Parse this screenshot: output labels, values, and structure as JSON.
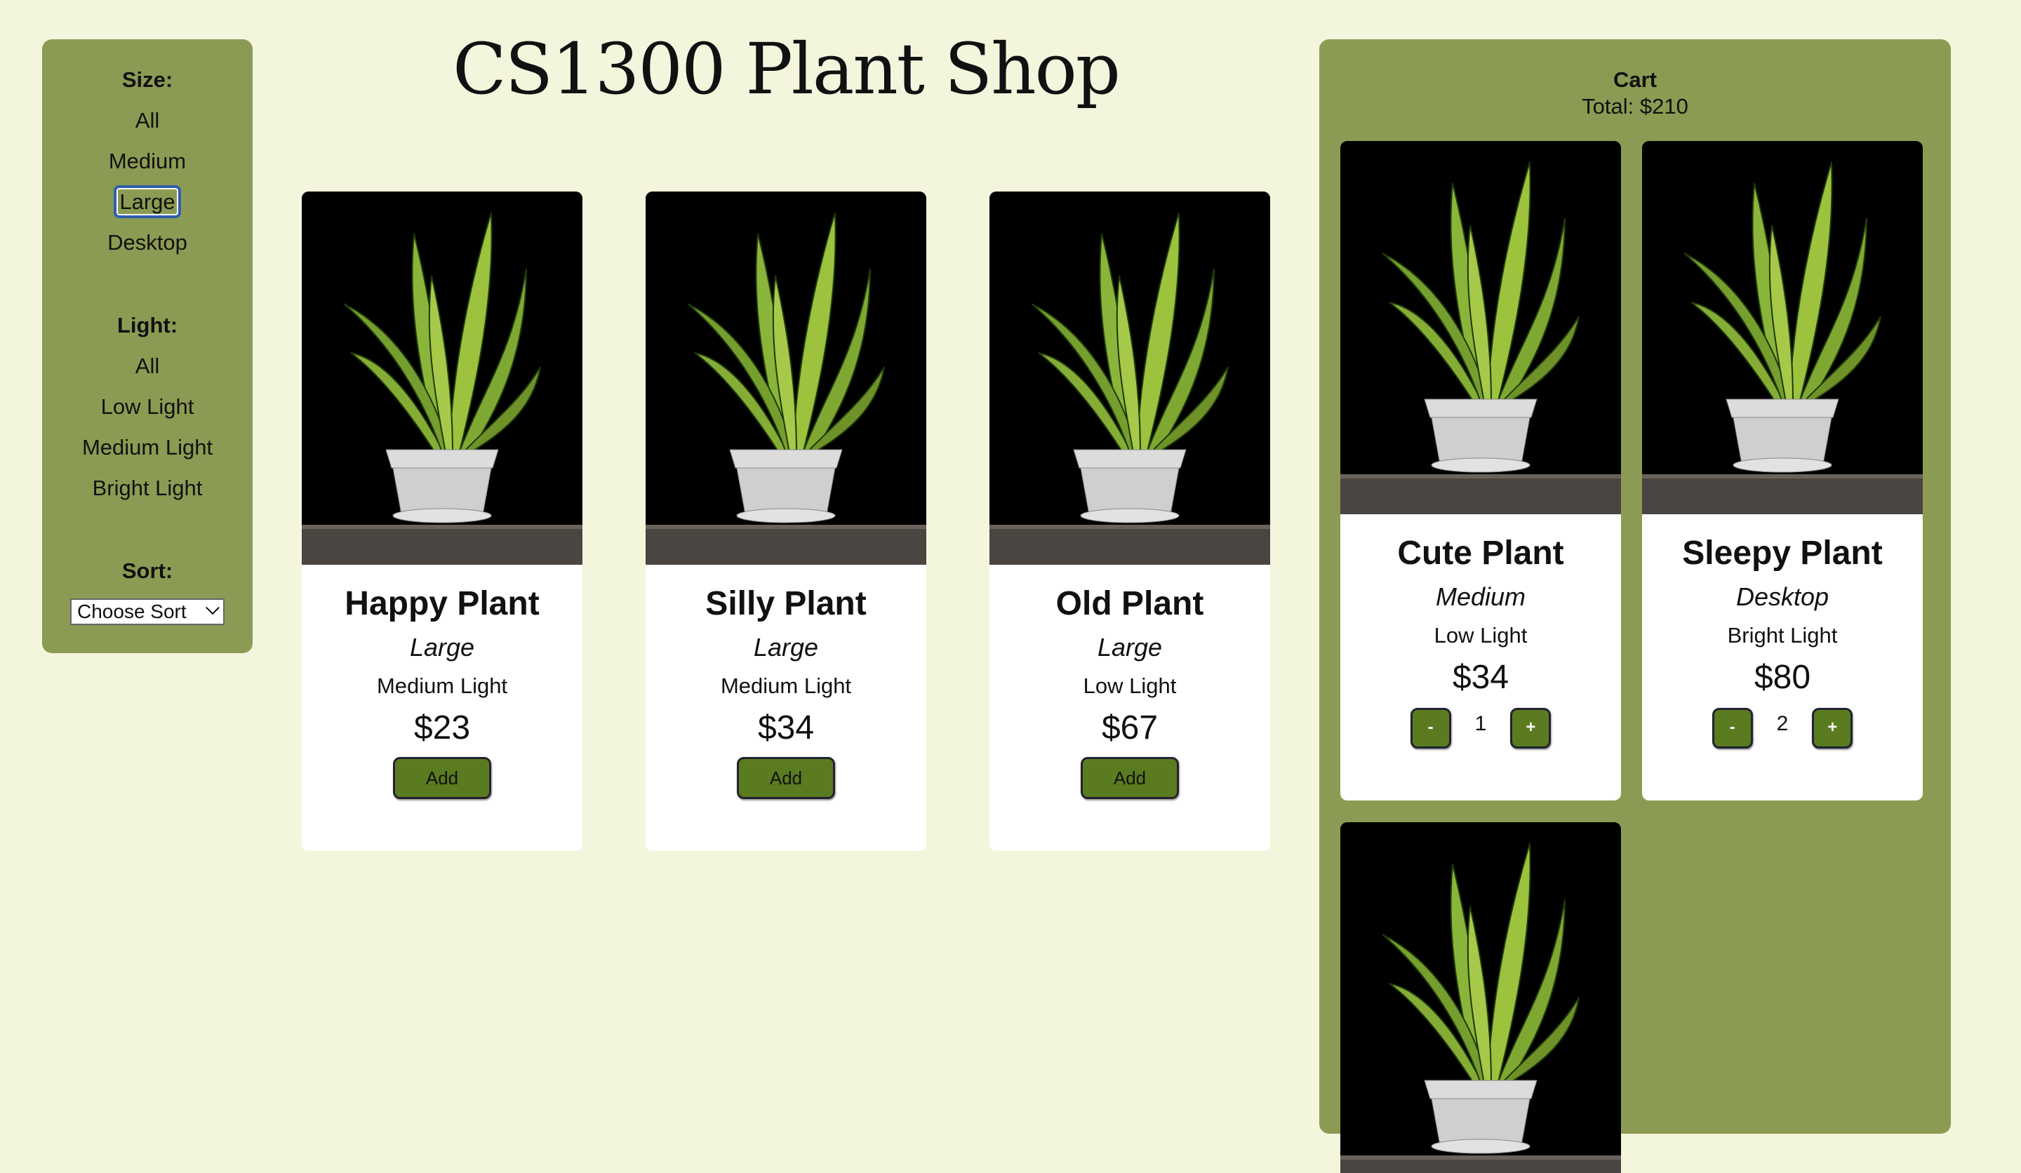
{
  "sidebar": {
    "size_heading": "Size:",
    "size_options": [
      "All",
      "Medium",
      "Large",
      "Desktop"
    ],
    "size_selected": "Large",
    "light_heading": "Light:",
    "light_options": [
      "All",
      "Low Light",
      "Medium Light",
      "Bright Light"
    ],
    "sort_heading": "Sort:",
    "sort_value": "Choose Sort"
  },
  "title": "CS1300 Plant Shop",
  "products": [
    {
      "name": "Happy Plant",
      "size": "Large",
      "light": "Medium Light",
      "price": "$23",
      "button": "Add"
    },
    {
      "name": "Silly Plant",
      "size": "Large",
      "light": "Medium Light",
      "price": "$34",
      "button": "Add"
    },
    {
      "name": "Old Plant",
      "size": "Large",
      "light": "Low Light",
      "price": "$67",
      "button": "Add"
    }
  ],
  "cart": {
    "title": "Cart",
    "total": "Total: $210",
    "items": [
      {
        "name": "Cute Plant",
        "size": "Medium",
        "light": "Low Light",
        "price": "$34",
        "qty": "1",
        "minus": "-",
        "plus": "+"
      },
      {
        "name": "Sleepy Plant",
        "size": "Desktop",
        "light": "Bright Light",
        "price": "$80",
        "qty": "2",
        "minus": "-",
        "plus": "+"
      }
    ]
  },
  "colors": {
    "background": "#f4f5dd",
    "panel": "#8c9b53",
    "button": "#5a7b1f",
    "selected_outline": "#2f5fb0"
  },
  "icons": {
    "plant_image": "snake-plant-photo",
    "select_chevron": "chevron-down-icon"
  }
}
